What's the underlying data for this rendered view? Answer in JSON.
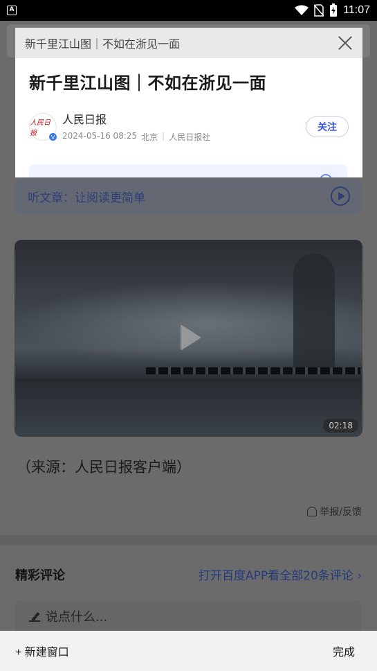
{
  "status_bar": {
    "app_icon": "A",
    "time": "11:07",
    "icons": [
      "wifi-icon",
      "no-sim-icon",
      "battery-charging-icon"
    ]
  },
  "tab_card": {
    "tab_title": "新千里江山图｜不如在浙见一面",
    "article_title": "新千里江山图｜不如在浙见一面",
    "author": {
      "name": "人民日报",
      "avatar_text": "人民日报",
      "verified_badge": "V",
      "date": "2024-05-16 08:25",
      "location": "北京",
      "publisher": "人民日报社"
    },
    "follow_label": "关注"
  },
  "background_page": {
    "listen_label": "听文章：让阅读更简单",
    "video_duration": "02:18",
    "source_text": "（来源：人民日报客户端）",
    "report_label": "举报/反馈",
    "comments_title": "精彩评论",
    "open_app_link": "打开百度APP看全部20条评论 ›",
    "comment_placeholder": "说点什么..."
  },
  "bottom_bar": {
    "new_window_label": "+ 新建窗口",
    "done_label": "完成"
  },
  "colors": {
    "accent": "#3a5bd9",
    "link_dimmed": "#243a7c",
    "overlay_bg": "#6b6b6b"
  }
}
